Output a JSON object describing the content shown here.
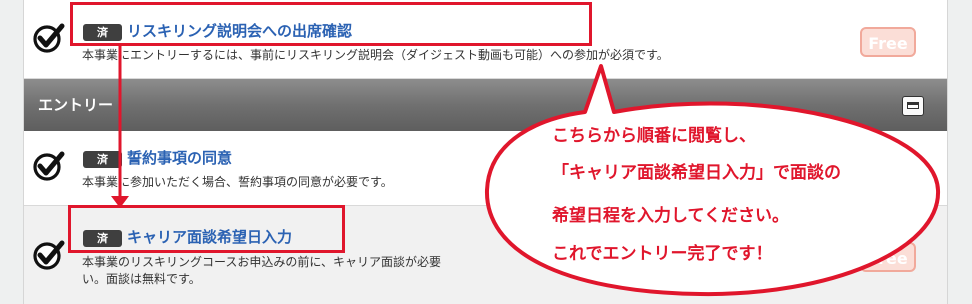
{
  "items": [
    {
      "status_badge": "済",
      "title": "リスキリング説明会への出席確認",
      "description": "本事業にエントリーするには、事前にリスキリング説明会（ダイジェスト動画も可能）への参加が必須です。",
      "free_label": "Free"
    },
    {
      "status_badge": "済",
      "title": "誓約事項の同意",
      "description": "本事業に参加いただく場合、誓約事項の同意が必要です。"
    },
    {
      "status_badge": "済",
      "title": "キャリア面談希望日入力",
      "description_line1": "本事業のリスキリングコースお申込みの前に、キャリア面談が必要",
      "description_line2": "い。面談は無料です。",
      "free_label": "Free"
    }
  ],
  "section": {
    "title": "エントリー"
  },
  "callout": {
    "line1": "こちらから順番に閲覧し、",
    "line2": "「キャリア面談希望日入力」で面談の",
    "line3": "希望日程を入力してください。",
    "line4": "これでエントリー完了です！"
  },
  "colors": {
    "accent_red": "#e0162c",
    "link_blue": "#2b62b3",
    "badge_dark": "#3f3f3f",
    "free_pink": "#fbded7"
  }
}
